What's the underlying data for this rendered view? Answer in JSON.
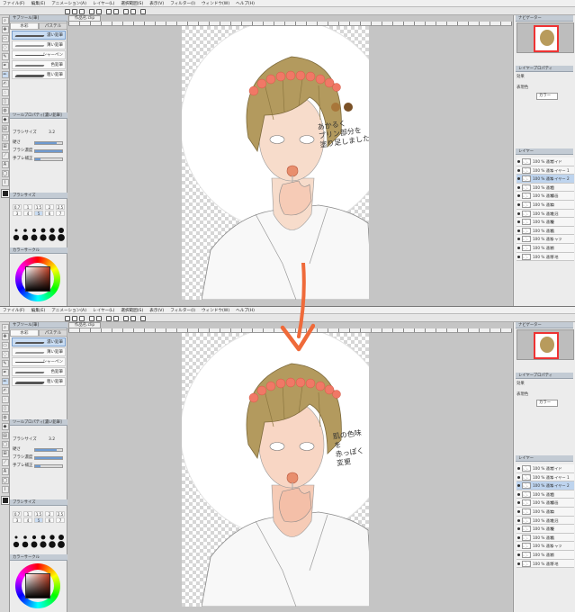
{
  "menu": [
    "ファイル(F)",
    "編集(E)",
    "アニメーション(A)",
    "レイヤー(L)",
    "選択範囲(S)",
    "表示(V)",
    "フィルター(I)",
    "ウィンドウ(W)",
    "ヘルプ(H)"
  ],
  "left_panel": {
    "sub_tool_header": "サブツール[筆]",
    "tabs": [
      "水彩",
      "パステル"
    ],
    "brushes": [
      "濃い鉛筆",
      "薄い鉛筆",
      "シャーペン",
      "色鉛筆",
      "粗い鉛筆"
    ],
    "tool_property_header": "ツールプロパティ[濃い鉛筆]",
    "brush_size_label": "ブラシサイズ",
    "brush_size_value": "3.2",
    "hardness_label": "硬さ",
    "density_label": "ブラシ濃度",
    "density_value": "100",
    "stabilization_label": "手ブレ補正",
    "stabilization_value": "6",
    "brush_size_header": "ブラシサイズ",
    "sizes": [
      "0.7",
      "1",
      "1.5",
      "2",
      "2.5",
      "3",
      "4",
      "5",
      "6",
      "7",
      "8",
      "10",
      "12",
      "15",
      "17"
    ],
    "color_header": "カラーサークル"
  },
  "doc_tab": "作品名.clip",
  "right_panel": {
    "navigator_header": "ナビゲーター",
    "layer_property_header": "レイヤープロパティ",
    "effect_label": "効果",
    "expression_label": "表現色",
    "expression_value": "カラー",
    "layers_header": "レイヤー"
  },
  "shot1": {
    "note": "あかるく\nプリン部分を\n塗り足しました",
    "swatches": [
      "#a8763a",
      "#7a5127"
    ],
    "layers": [
      {
        "opacity": "100 %",
        "mode": "通常",
        "name": "ガイド",
        "sel": false
      },
      {
        "opacity": "100 %",
        "mode": "通常",
        "name": "レイヤー 1",
        "sel": false
      },
      {
        "opacity": "100 %",
        "mode": "通常",
        "name": "レイヤー 2",
        "sel": true
      },
      {
        "opacity": "100 %",
        "mode": "通常",
        "name": "目",
        "sel": false
      },
      {
        "opacity": "100 %",
        "mode": "通常",
        "name": "線画",
        "sel": false
      },
      {
        "opacity": "100 %",
        "mode": "通常",
        "name": "口",
        "sel": false
      },
      {
        "opacity": "100 %",
        "mode": "通常",
        "name": "花冠",
        "sel": false
      },
      {
        "opacity": "100 %",
        "mode": "通常",
        "name": "髪",
        "sel": false
      },
      {
        "opacity": "100 %",
        "mode": "通常",
        "name": "肌",
        "sel": false
      },
      {
        "opacity": "100 %",
        "mode": "通常",
        "name": "シャツ",
        "sel": false
      },
      {
        "opacity": "100 %",
        "mode": "通常",
        "name": "爪",
        "sel": false
      },
      {
        "opacity": "100 %",
        "mode": "通常",
        "name": "下地",
        "sel": false
      }
    ]
  },
  "shot2": {
    "note": "肌の色味を\n赤っぽく変更",
    "layers": [
      {
        "opacity": "100 %",
        "mode": "通常",
        "name": "ガイド",
        "sel": false
      },
      {
        "opacity": "100 %",
        "mode": "通常",
        "name": "レイヤー 1",
        "sel": false
      },
      {
        "opacity": "100 %",
        "mode": "通常",
        "name": "レイヤー 2",
        "sel": true
      },
      {
        "opacity": "100 %",
        "mode": "通常",
        "name": "目",
        "sel": false
      },
      {
        "opacity": "100 %",
        "mode": "通常",
        "name": "線画",
        "sel": false
      },
      {
        "opacity": "100 %",
        "mode": "通常",
        "name": "口",
        "sel": false
      },
      {
        "opacity": "100 %",
        "mode": "通常",
        "name": "花冠",
        "sel": false
      },
      {
        "opacity": "100 %",
        "mode": "通常",
        "name": "髪",
        "sel": false
      },
      {
        "opacity": "100 %",
        "mode": "通常",
        "name": "肌",
        "sel": false
      },
      {
        "opacity": "100 %",
        "mode": "通常",
        "name": "シャツ",
        "sel": false
      },
      {
        "opacity": "100 %",
        "mode": "通常",
        "name": "爪",
        "sel": false
      },
      {
        "opacity": "100 %",
        "mode": "通常",
        "name": "下地",
        "sel": false
      }
    ]
  },
  "colors": {
    "arrow": "#ef6a3a",
    "flower": "#f07866",
    "hair": "#b39a5e",
    "skin": "#f7dccb",
    "skin2": "#f6cbb6",
    "selection": "#bed4ee"
  }
}
